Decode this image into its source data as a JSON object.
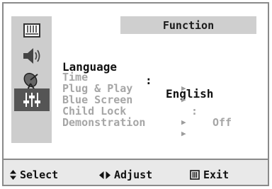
{
  "menu": {
    "title": "Function",
    "items": [
      {
        "label": "Language",
        "separator": ":",
        "value": "English",
        "selected": true
      },
      {
        "label": "Time",
        "arrow": "▶"
      },
      {
        "label": "Plug & Play",
        "arrow": "▶"
      },
      {
        "label": "Blue Screen",
        "separator": ":",
        "value": "Off"
      },
      {
        "label": "Child Lock",
        "arrow": "▶"
      },
      {
        "label": "Demonstration",
        "arrow": "▶"
      }
    ]
  },
  "sidebar": {
    "icons": [
      {
        "name": "picture-icon"
      },
      {
        "name": "sound-icon"
      },
      {
        "name": "channel-antenna-icon"
      },
      {
        "name": "function-settings-icon",
        "active": true
      }
    ]
  },
  "footer": {
    "select_icon": "▲▼",
    "select_label": "Select",
    "adjust_icon": "◀▶",
    "adjust_label": "Adjust",
    "exit_icon": "Ⅲ",
    "exit_label": "Exit"
  },
  "colors": {
    "rail": "#cdcdcd",
    "active_tab": "#555555",
    "title_bar": "#cfcfcf",
    "selected_text": "#111111",
    "dim_text": "#a6a6a6"
  }
}
